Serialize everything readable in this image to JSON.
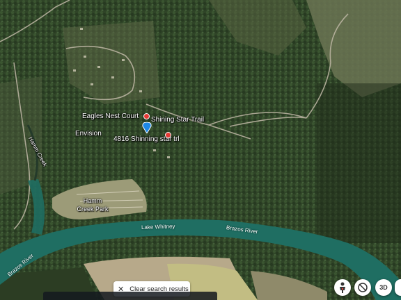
{
  "labels": {
    "eagles_nest": "Eagles Nest Court",
    "shining_star_trail": "Shining Star Trail",
    "envision": "Envision",
    "address": "4816 Shinning star trl",
    "hamm_creek": "Hamm Creek",
    "hamm_creek_park": "Hamm Creek Park",
    "lake_whitney": "Lake Whitney",
    "brazos_river_east": "Brazos River",
    "brazos_river_west": "Brazos River"
  },
  "toast": {
    "close_icon": "close-icon",
    "text": "Clear search results"
  },
  "controls": {
    "streetview_icon": "pegman-icon",
    "rotate_icon": "rotate-icon",
    "threed_label": "3D"
  },
  "colors": {
    "water": "#1f6e62",
    "pin_red": "#e53935",
    "pin_blue": "#1e88e5"
  }
}
